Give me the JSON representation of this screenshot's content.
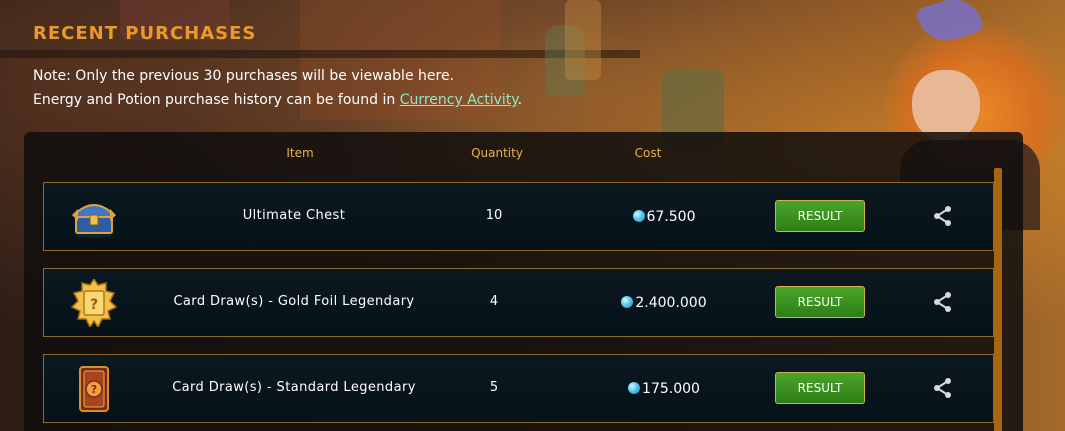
{
  "header": {
    "title": "RECENT PURCHASES"
  },
  "note": {
    "line1": "Note: Only the previous 30 purchases will be viewable here.",
    "line2_prefix": "Energy and Potion purchase history can be found in ",
    "link_label": "Currency Activity",
    "line2_suffix": "."
  },
  "table": {
    "columns": {
      "item": "Item",
      "quantity": "Quantity",
      "cost": "Cost"
    },
    "rows": [
      {
        "name": "Ultimate Chest",
        "quantity": "10",
        "cost": "67.500",
        "icon": "chest-icon",
        "result_label": "RESULT"
      },
      {
        "name": "Card Draw(s) - Gold Foil Legendary",
        "quantity": "4",
        "cost": "2.400.000",
        "icon": "gold-card-icon",
        "result_label": "RESULT"
      },
      {
        "name": "Card Draw(s) - Standard Legendary",
        "quantity": "5",
        "cost": "175.000",
        "icon": "legendary-card-icon",
        "result_label": "RESULT"
      }
    ]
  },
  "colors": {
    "accent_orange": "#e99a2a",
    "column_header": "#e8b44a",
    "link": "#8fe6c9",
    "button_green": "#3c9320",
    "row_border": "#8c6b2a",
    "scrollbar": "#a8650f"
  }
}
